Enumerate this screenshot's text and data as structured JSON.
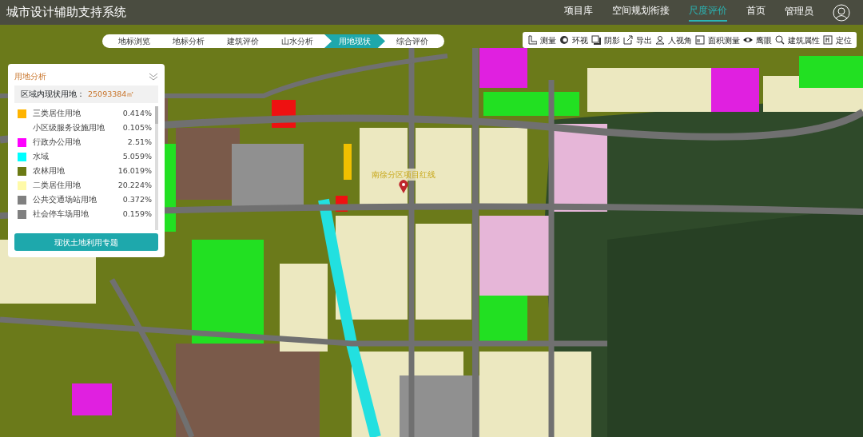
{
  "app_title": "城市设计辅助支持系统",
  "nav": [
    {
      "label": "项目库",
      "selected": false
    },
    {
      "label": "空间规划衔接",
      "selected": false
    },
    {
      "label": "尺度评价",
      "selected": true
    },
    {
      "label": "首页",
      "selected": false
    }
  ],
  "user": {
    "label": "管理员"
  },
  "steps": [
    {
      "label": "地标浏览",
      "selected": false
    },
    {
      "label": "地标分析",
      "selected": false
    },
    {
      "label": "建筑评价",
      "selected": false
    },
    {
      "label": "山水分析",
      "selected": false
    },
    {
      "label": "用地现状",
      "selected": true
    },
    {
      "label": "综合评价",
      "selected": false
    }
  ],
  "tools": [
    {
      "label": "测量",
      "kind": "ruler"
    },
    {
      "label": "环视",
      "kind": "orbit"
    },
    {
      "label": "阴影",
      "kind": "shadow"
    },
    {
      "label": "导出",
      "kind": "export"
    },
    {
      "label": "人视角",
      "kind": "person"
    },
    {
      "label": "面积测量",
      "kind": "area"
    },
    {
      "label": "鹰眼",
      "kind": "eye"
    },
    {
      "label": "建筑属性",
      "kind": "search"
    },
    {
      "label": "定位",
      "kind": "locate"
    }
  ],
  "panel": {
    "title": "用地分析",
    "summary_label": "区域内现状用地：",
    "summary_value": "25093384㎡",
    "items": [
      {
        "name": "三类居住用地",
        "share": "0.414%",
        "color": "#ffb400"
      },
      {
        "name": "小区级服务设施用地",
        "share": "0.105%"
      },
      {
        "name": "行政办公用地",
        "share": "2.51%",
        "color": "#ff00ff"
      },
      {
        "name": "水域",
        "share": "5.059%",
        "color": "#00ffff"
      },
      {
        "name": "农林用地",
        "share": "16.019%",
        "color": "#6b7a14"
      },
      {
        "name": "二类居住用地",
        "share": "20.224%",
        "color": "#fffaa8"
      },
      {
        "name": "公共交通场站用地",
        "share": "0.372%",
        "color": "#808080"
      },
      {
        "name": "社会停车场用地",
        "share": "0.159%",
        "color": "#808080"
      }
    ],
    "button": "现状土地利用专题"
  },
  "map_label": "南徐分区项目红线"
}
